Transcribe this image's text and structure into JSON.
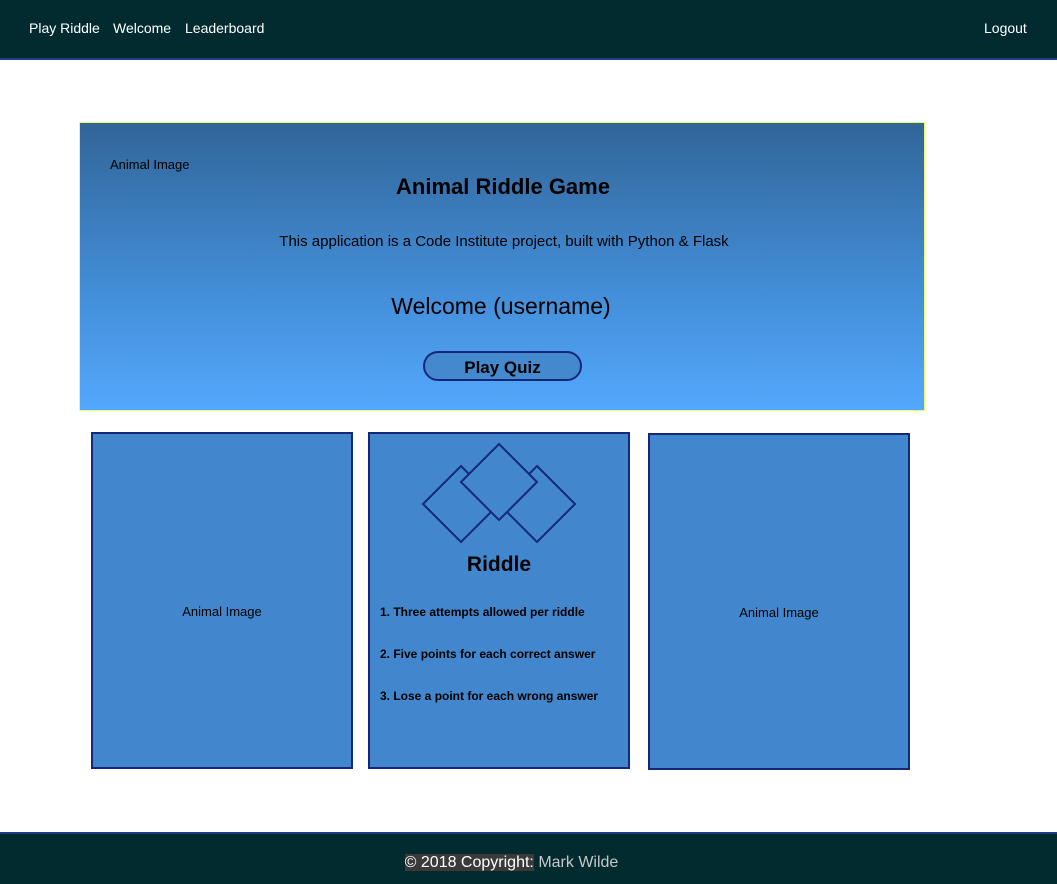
{
  "navbar": {
    "links": [
      {
        "label": "Play Riddle"
      },
      {
        "label": "Welcome"
      },
      {
        "label": "Leaderboard"
      }
    ],
    "logout_label": "Logout"
  },
  "hero": {
    "image_placeholder": "Animal Image",
    "title": "Animal Riddle Game",
    "subtitle": "This application is a Code Institute project, built with Python & Flask",
    "welcome": "Welcome (username)",
    "play_button_label": "Play Quiz"
  },
  "cards": {
    "left": {
      "image_placeholder": "Animal Image"
    },
    "middle": {
      "icon": "diamonds-icon",
      "title": "Riddle",
      "rules": [
        "1. Three attempts allowed per riddle",
        "2. Five points for each correct answer",
        "3. Lose a point for each wrong answer"
      ]
    },
    "right": {
      "image_placeholder": "Animal Image"
    }
  },
  "footer": {
    "copyright": "© 2018 Copyright:",
    "author": "Mark Wilde"
  },
  "colors": {
    "navbar_bg": "#012b2f",
    "hero_gradient_top": "#326598",
    "hero_gradient_bottom": "#53a8fd",
    "card_bg": "#4287cd",
    "border_dark_blue": "#13287a"
  }
}
